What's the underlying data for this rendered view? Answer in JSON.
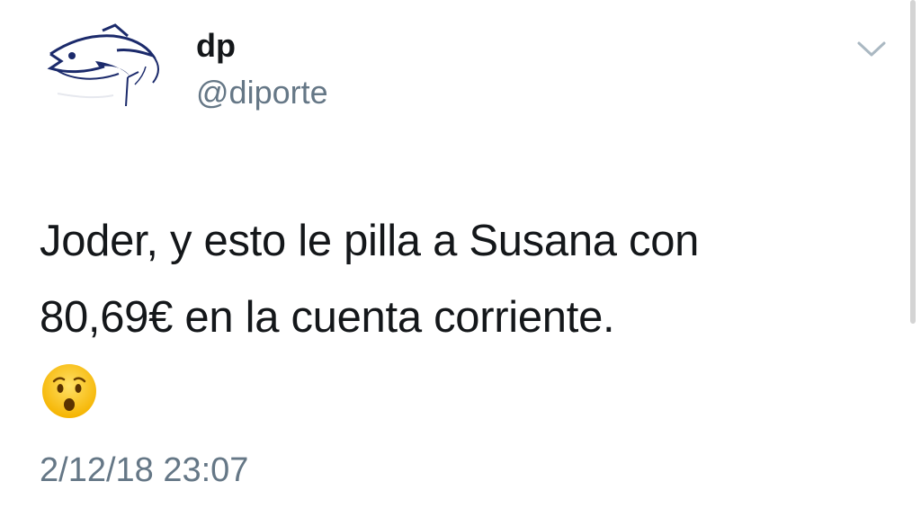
{
  "tweet": {
    "display_name": "dp",
    "handle": "@diporte",
    "text_line1": "Joder, y esto le pilla a Susana con",
    "text_line2": "80,69€ en la cuenta corriente.",
    "emoji": "hushed-face",
    "timestamp": "2/12/18 23:07"
  },
  "icons": {
    "avatar": "fish-logo",
    "menu": "chevron-down-icon"
  },
  "colors": {
    "text": "#14171a",
    "secondary": "#657786",
    "background": "#ffffff",
    "avatar_ink": "#1b2a6b"
  }
}
